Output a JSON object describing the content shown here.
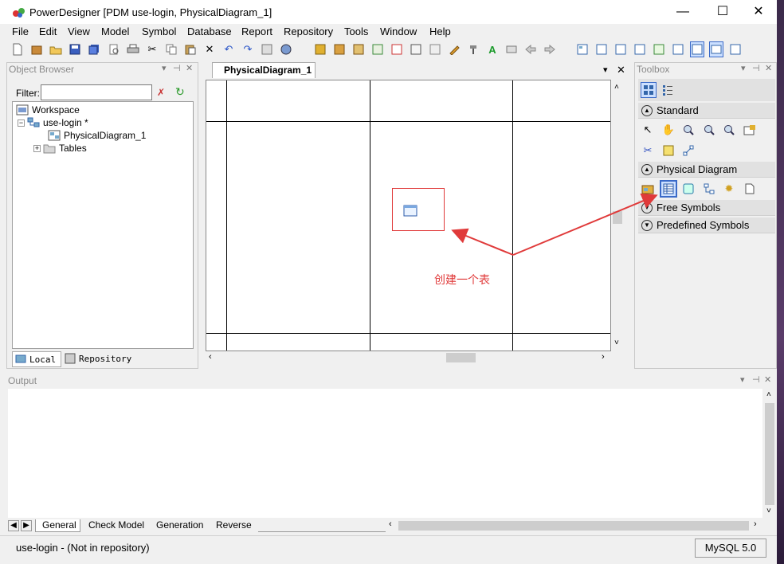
{
  "window": {
    "title": "PowerDesigner [PDM use-login, PhysicalDiagram_1]",
    "minimize": "—",
    "maximize": "☐",
    "close": "✕"
  },
  "menu": [
    "File",
    "Edit",
    "View",
    "Model",
    "Symbol",
    "Database",
    "Report",
    "Repository",
    "Tools",
    "Window",
    "Help"
  ],
  "object_browser": {
    "title": "Object Browser",
    "filter_label": "Filter:",
    "filter_value": "",
    "tree": [
      {
        "label": "Workspace",
        "icon": "workspace-icon"
      },
      {
        "label": "use-login *",
        "icon": "model-icon"
      },
      {
        "label": "PhysicalDiagram_1",
        "icon": "diagram-icon"
      },
      {
        "label": "Tables",
        "icon": "folder-icon"
      }
    ],
    "tabs": [
      "Local",
      "Repository"
    ]
  },
  "diagram": {
    "tab_label": "PhysicalDiagram_1"
  },
  "annotation": {
    "text": "创建一个表",
    "color": "#e03a3a"
  },
  "toolbox": {
    "title": "Toolbox",
    "groups": [
      {
        "label": "Standard",
        "expanded": true
      },
      {
        "label": "Physical Diagram",
        "expanded": true
      },
      {
        "label": "Free Symbols",
        "expanded": false
      },
      {
        "label": "Predefined Symbols",
        "expanded": false
      }
    ]
  },
  "output": {
    "title": "Output",
    "tabs": [
      "General",
      "Check Model",
      "Generation",
      "Reverse"
    ]
  },
  "status": {
    "left": "use-login - (Not in repository)",
    "dbms": "MySQL 5.0"
  }
}
